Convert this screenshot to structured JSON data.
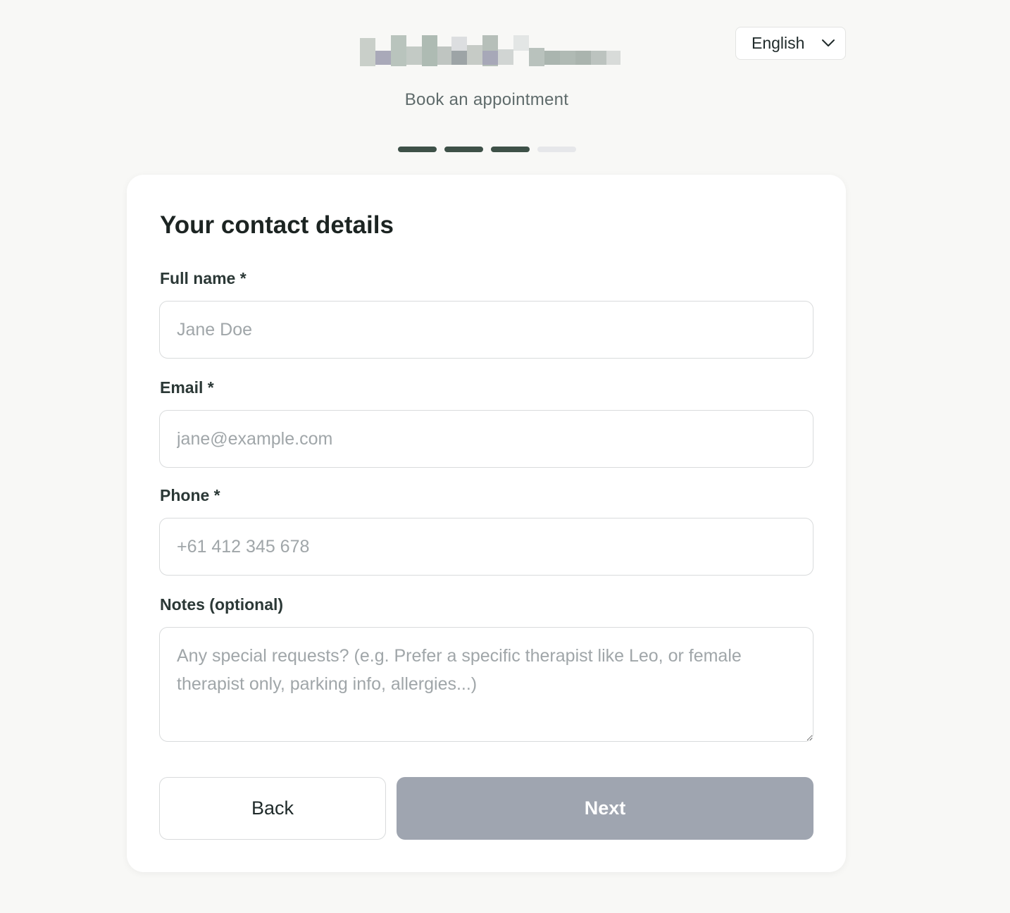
{
  "header": {
    "subtitle": "Book an appointment",
    "language": {
      "selected": "English",
      "icon": "chevron-down-icon"
    },
    "progress": {
      "total_steps": 4,
      "completed_steps": 3,
      "active_color": "#3e5148",
      "inactive_color": "#e6e7ea"
    }
  },
  "form": {
    "title": "Your contact details",
    "full_name": {
      "label": "Full name *",
      "placeholder": "Jane Doe",
      "value": ""
    },
    "email": {
      "label": "Email *",
      "placeholder": "jane@example.com",
      "value": ""
    },
    "phone": {
      "label": "Phone *",
      "placeholder": "+61 412 345 678",
      "value": ""
    },
    "notes": {
      "label": "Notes (optional)",
      "placeholder": "Any special requests? (e.g. Prefer a specific therapist like Leo, or female therapist only, parking info, allergies...)",
      "value": ""
    }
  },
  "actions": {
    "back_label": "Back",
    "next_label": "Next",
    "next_disabled": true,
    "next_color": "#9fa5b0"
  }
}
